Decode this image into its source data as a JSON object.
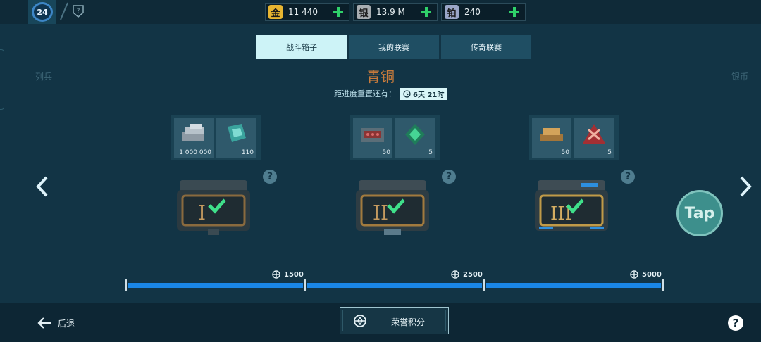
{
  "header": {
    "level": "24",
    "currencies": [
      {
        "glyph": "金",
        "value": "11 440",
        "color": "#e7b531"
      },
      {
        "glyph": "银",
        "value": "13.9 M",
        "color": "#a8adb1"
      },
      {
        "glyph": "铂",
        "value": "240",
        "color": "#9aa6c8"
      }
    ]
  },
  "tabs": [
    {
      "label": "战斗箱子",
      "active": true
    },
    {
      "label": "我的联赛",
      "active": false
    },
    {
      "label": "传奇联赛",
      "active": false
    }
  ],
  "league": {
    "prev_label": "列兵",
    "title": "青铜",
    "next_label": "银币",
    "reset_label": "距进度重置还有：",
    "reset_time": "6天 21时"
  },
  "rewards": [
    {
      "items": [
        {
          "amount": "1 000 000",
          "icon": "silver-stack-icon"
        },
        {
          "amount": "110",
          "icon": "blueprint-icon"
        }
      ],
      "chest_numeral": "I",
      "claimed": true
    },
    {
      "items": [
        {
          "amount": "50",
          "icon": "ammo-crate-icon"
        },
        {
          "amount": "5",
          "icon": "green-booster-icon"
        }
      ],
      "chest_numeral": "II",
      "claimed": true
    },
    {
      "items": [
        {
          "amount": "50",
          "icon": "gold-bars-icon"
        },
        {
          "amount": "5",
          "icon": "red-booster-icon"
        }
      ],
      "chest_numeral": "III",
      "claimed": true
    }
  ],
  "milestones": [
    "1500",
    "2500",
    "5000"
  ],
  "progress_fraction": 1.0,
  "tap_label": "Tap",
  "footer": {
    "back_label": "后退",
    "honor_label": "荣誉积分"
  },
  "colors": {
    "accent_blue": "#1a86e6",
    "check_green": "#3fe08a",
    "league_bronze": "#c87b3c"
  }
}
